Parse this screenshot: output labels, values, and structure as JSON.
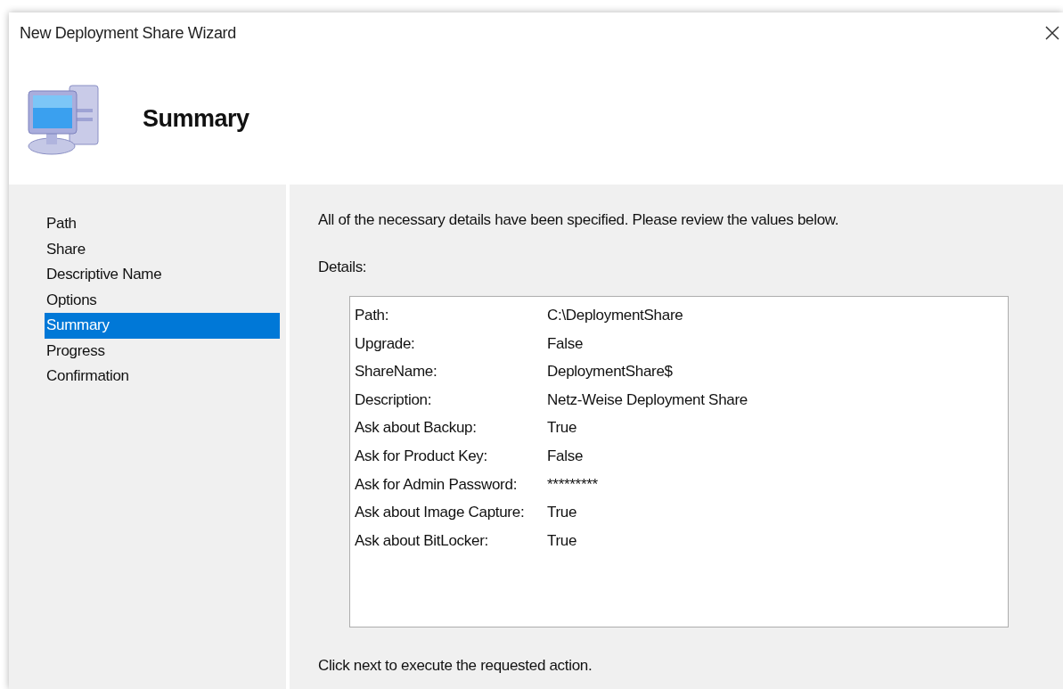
{
  "window": {
    "title": "New Deployment Share Wizard"
  },
  "header": {
    "title": "Summary"
  },
  "steps": [
    {
      "label": "Path",
      "selected": false
    },
    {
      "label": "Share",
      "selected": false
    },
    {
      "label": "Descriptive Name",
      "selected": false
    },
    {
      "label": "Options",
      "selected": false
    },
    {
      "label": "Summary",
      "selected": true
    },
    {
      "label": "Progress",
      "selected": false
    },
    {
      "label": "Confirmation",
      "selected": false
    }
  ],
  "intro": "All of the necessary details have been specified.  Please review the values below.",
  "details_label": "Details:",
  "details": [
    {
      "name": "Path:",
      "value": "C:\\DeploymentShare"
    },
    {
      "name": "Upgrade:",
      "value": "False"
    },
    {
      "name": "ShareName:",
      "value": "DeploymentShare$"
    },
    {
      "name": "Description:",
      "value": "Netz-Weise Deployment Share"
    },
    {
      "name": "Ask about Backup:",
      "value": "True"
    },
    {
      "name": "Ask for Product Key:",
      "value": "False"
    },
    {
      "name": "Ask for Admin Password:",
      "value": "*********"
    },
    {
      "name": "Ask about Image Capture:",
      "value": "True"
    },
    {
      "name": "Ask about BitLocker:",
      "value": "True"
    }
  ],
  "footer_note": "Click next to execute the requested action."
}
